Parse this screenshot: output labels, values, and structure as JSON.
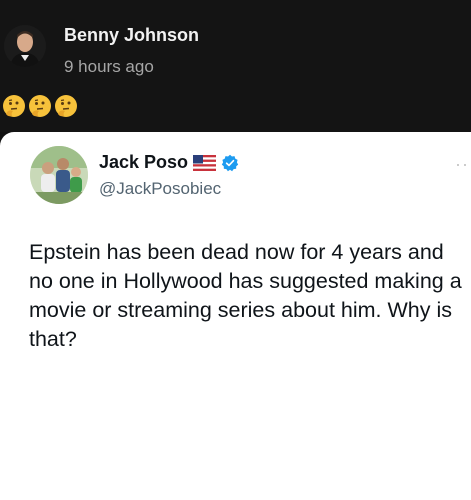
{
  "post": {
    "author": "Benny Johnson",
    "time": "9 hours ago",
    "caption_emojis": [
      "thinking-face",
      "thinking-face",
      "thinking-face"
    ]
  },
  "tweet": {
    "display_name": "Jack Poso",
    "handle": "@JackPosobiec",
    "text_lines": [
      "Epstein has been dead now for 4 years and",
      "no one in Hollywood has suggested making a",
      "movie or streaming series about him. Why is",
      "that?"
    ]
  },
  "colors": {
    "header_bg": "#141414",
    "card_bg": "#ffffff",
    "verified_blue": "#1d9bf0"
  }
}
